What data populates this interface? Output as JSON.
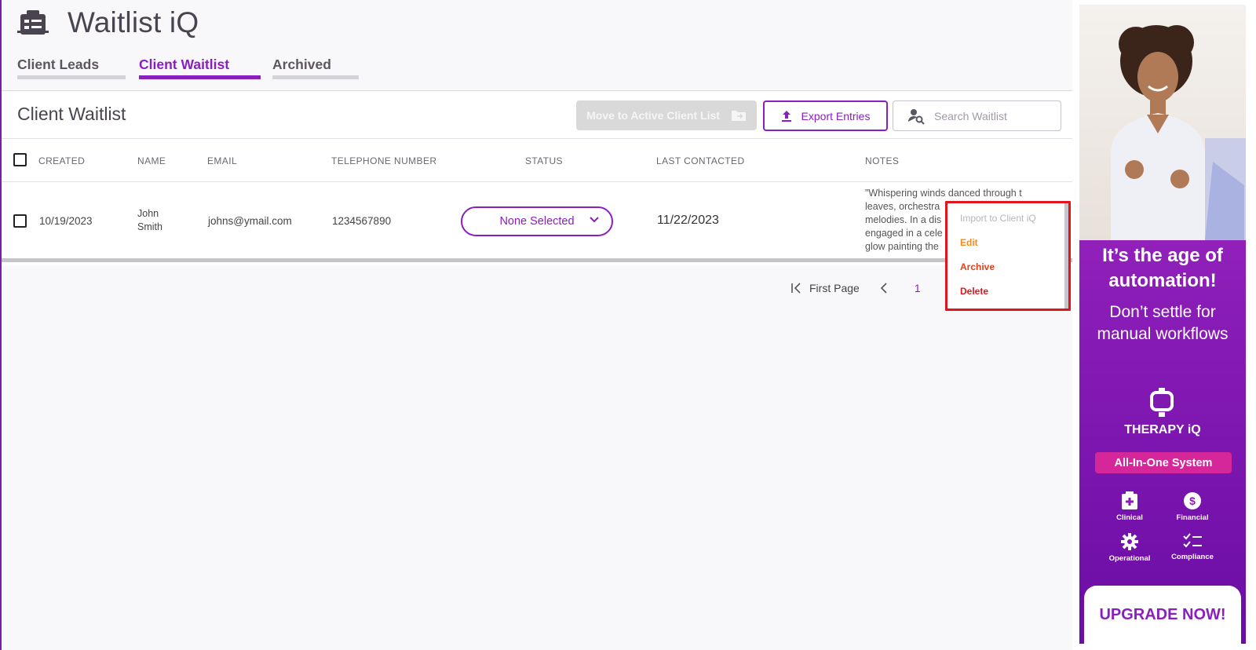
{
  "app": {
    "title": "Waitlist iQ",
    "icon": "clipboard-list-icon"
  },
  "tabs": [
    {
      "label": "Client Leads",
      "active": false
    },
    {
      "label": "Client Waitlist",
      "active": true
    },
    {
      "label": "Archived",
      "active": false
    }
  ],
  "panel": {
    "title": "Client Waitlist",
    "move_button": "Move to Active Client List",
    "export_button": "Export Entries",
    "search_placeholder": "Search Waitlist"
  },
  "table": {
    "columns": [
      "CREATED",
      "NAME",
      "EMAIL",
      "TELEPHONE NUMBER",
      "STATUS",
      "LAST CONTACTED",
      "NOTES"
    ],
    "rows": [
      {
        "created": "10/19/2023",
        "name_first": "John",
        "name_last": "Smith",
        "email": "johns@ymail.com",
        "phone": "1234567890",
        "status": "None Selected",
        "last_contacted": "11/22/2023",
        "notes": [
          "\"Whispering winds danced through t",
          "leaves, orchestra",
          "melodies. In a dis",
          "engaged in a cele",
          "glow painting the"
        ]
      }
    ]
  },
  "pagination": {
    "first_label": "First Page",
    "current_page": "1"
  },
  "context_menu": {
    "items": [
      {
        "label": "Import to Client iQ",
        "color": "#b9b3bd",
        "disabled": true
      },
      {
        "label": "Edit",
        "color": "#f08a1c",
        "disabled": false
      },
      {
        "label": "Archive",
        "color": "#e0421c",
        "disabled": false
      },
      {
        "label": "Delete",
        "color": "#e0161c",
        "disabled": false
      }
    ]
  },
  "ad": {
    "headline1": "It’s the age of",
    "headline2": "automation!",
    "sub1": "Don’t settle for",
    "sub2": "manual workflows",
    "brand": "THERAPY iQ",
    "badge": "All-In-One System",
    "features": [
      {
        "label": "Clinical",
        "icon": "medical-folder-icon"
      },
      {
        "label": "Financial",
        "icon": "dollar-icon"
      },
      {
        "label": "Operational",
        "icon": "gear-icon"
      },
      {
        "label": "Compliance",
        "icon": "checklist-icon"
      }
    ],
    "cta": "UPGRADE NOW!"
  },
  "colors": {
    "brand": "#8a1fbf",
    "highlight": "#e0161c"
  }
}
